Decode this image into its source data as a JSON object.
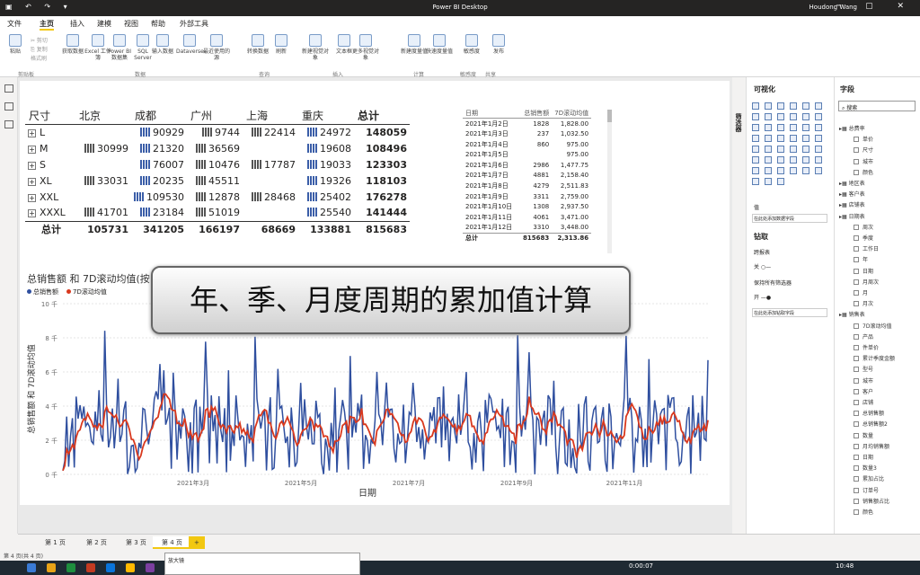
{
  "titlebar": {
    "title": "Power BI Desktop",
    "user": "Houdong Wang",
    "quick": "▣ ↶ ↷ ▾",
    "window": "─ ▢ ✕"
  },
  "menu": [
    "文件",
    "主页",
    "插入",
    "建模",
    "视图",
    "帮助",
    "外部工具"
  ],
  "ribbon": {
    "buttons": [
      "粘贴",
      "获取数据",
      "Excel 工作簿",
      "Power BI 数据集",
      "SQL Server",
      "输入数据",
      "Dataverse",
      "最近使用的源",
      "转换数据",
      "刷新",
      "新建视觉对象",
      "文本框",
      "更多视觉对象",
      "新建度量值",
      "快速度量值",
      "敏感度",
      "发布"
    ],
    "groups": [
      "剪贴板",
      "数据",
      "查询",
      "插入",
      "计算",
      "敏感度",
      "共享"
    ],
    "clip": [
      "✂ 剪切",
      "⎘ 复制",
      "格式刷"
    ]
  },
  "matrix": {
    "headers": [
      "尺寸",
      "北京",
      "成都",
      "广州",
      "上海",
      "重庆",
      "总计"
    ],
    "rows": [
      {
        "k": "L",
        "v": [
          "",
          "90929",
          "9744",
          "22414",
          "24972",
          "148059"
        ]
      },
      {
        "k": "M",
        "v": [
          "30999",
          "21320",
          "36569",
          "",
          "19608",
          "108496"
        ]
      },
      {
        "k": "S",
        "v": [
          "",
          "76007",
          "10476",
          "17787",
          "19033",
          "123303"
        ]
      },
      {
        "k": "XL",
        "v": [
          "33031",
          "20235",
          "45511",
          "",
          "19326",
          "118103"
        ]
      },
      {
        "k": "XXL",
        "v": [
          "",
          "109530",
          "12878",
          "28468",
          "25402",
          "176278"
        ]
      },
      {
        "k": "XXXL",
        "v": [
          "41701",
          "23184",
          "51019",
          "",
          "25540",
          "141444"
        ]
      }
    ],
    "total": {
      "k": "总计",
      "v": [
        "105731",
        "341205",
        "166197",
        "68669",
        "133881",
        "815683"
      ]
    }
  },
  "table": {
    "headers": [
      "日期",
      "总销售额",
      "7D滚动均值"
    ],
    "rows": [
      [
        "2021年1月2日",
        "1828",
        "1,828.00"
      ],
      [
        "2021年1月3日",
        "237",
        "1,032.50"
      ],
      [
        "2021年1月4日",
        "860",
        "975.00"
      ],
      [
        "2021年1月5日",
        "",
        "975.00"
      ],
      [
        "2021年1月6日",
        "2986",
        "1,477.75"
      ],
      [
        "2021年1月7日",
        "4881",
        "2,158.40"
      ],
      [
        "2021年1月8日",
        "4279",
        "2,511.83"
      ],
      [
        "2021年1月9日",
        "3311",
        "2,759.00"
      ],
      [
        "2021年1月10日",
        "1308",
        "2,937.50"
      ],
      [
        "2021年1月11日",
        "4061",
        "3,471.00"
      ],
      [
        "2021年1月12日",
        "3310",
        "3,448.00"
      ]
    ],
    "total": [
      "总计",
      "815683",
      "2,313.86"
    ]
  },
  "banner": "年、季、月度周期的累加值计算",
  "chart_data": {
    "type": "line",
    "title": "总销售额 和 7D滚动均值(按",
    "xlabel": "日期",
    "ylabel": "总销售额 和 7D滚动均值",
    "yticks": [
      "0 千",
      "2 千",
      "4 千",
      "6 千",
      "8 千",
      "10 千"
    ],
    "ylim": [
      0,
      10000
    ],
    "xticks": [
      "2021年3月",
      "2021年5月",
      "2021年7月",
      "2021年9月",
      "2021年11月"
    ],
    "series": [
      {
        "name": "总销售额",
        "color": "#2f4f9f"
      },
      {
        "name": "7D滚动均值",
        "color": "#d9391e"
      }
    ]
  },
  "viz": {
    "title": "可视化",
    "values": "值",
    "add": "在此处添加数据字段",
    "drill": "钻取",
    "cross": "跨报表",
    "off": "关 ○—",
    "keep": "保持所有筛选器",
    "on": "开 —●",
    "drilladd": "在此处添加钻取字段"
  },
  "fields": {
    "title": "字段",
    "search": "搜索",
    "items": [
      "总费率",
      "单价",
      "尺寸",
      "城市",
      "颜色",
      "地区表",
      "客户表",
      "店铺表",
      "日期表",
      "周次",
      "季度",
      "工作日",
      "年",
      "日期",
      "月周次",
      "月",
      "月次",
      "销售表",
      "7D滚动均值",
      "产品",
      "件单价",
      "累计季度金额",
      "型号",
      "城市",
      "客户",
      "店铺",
      "总销售额",
      "总销售额2",
      "数量",
      "月均销售额",
      "日期",
      "数量3",
      "累加占比",
      "订单号",
      "销售额占比",
      "颜色"
    ]
  },
  "tabs": [
    "第 1 页",
    "第 2 页",
    "第 3 页",
    "第 4 页",
    "+"
  ],
  "status": "第 4 页(共 4 页)",
  "taskbar": {
    "time": "10:48",
    "rec": "0:00:07",
    "mini": "放大镜"
  },
  "filters": "筛选器"
}
